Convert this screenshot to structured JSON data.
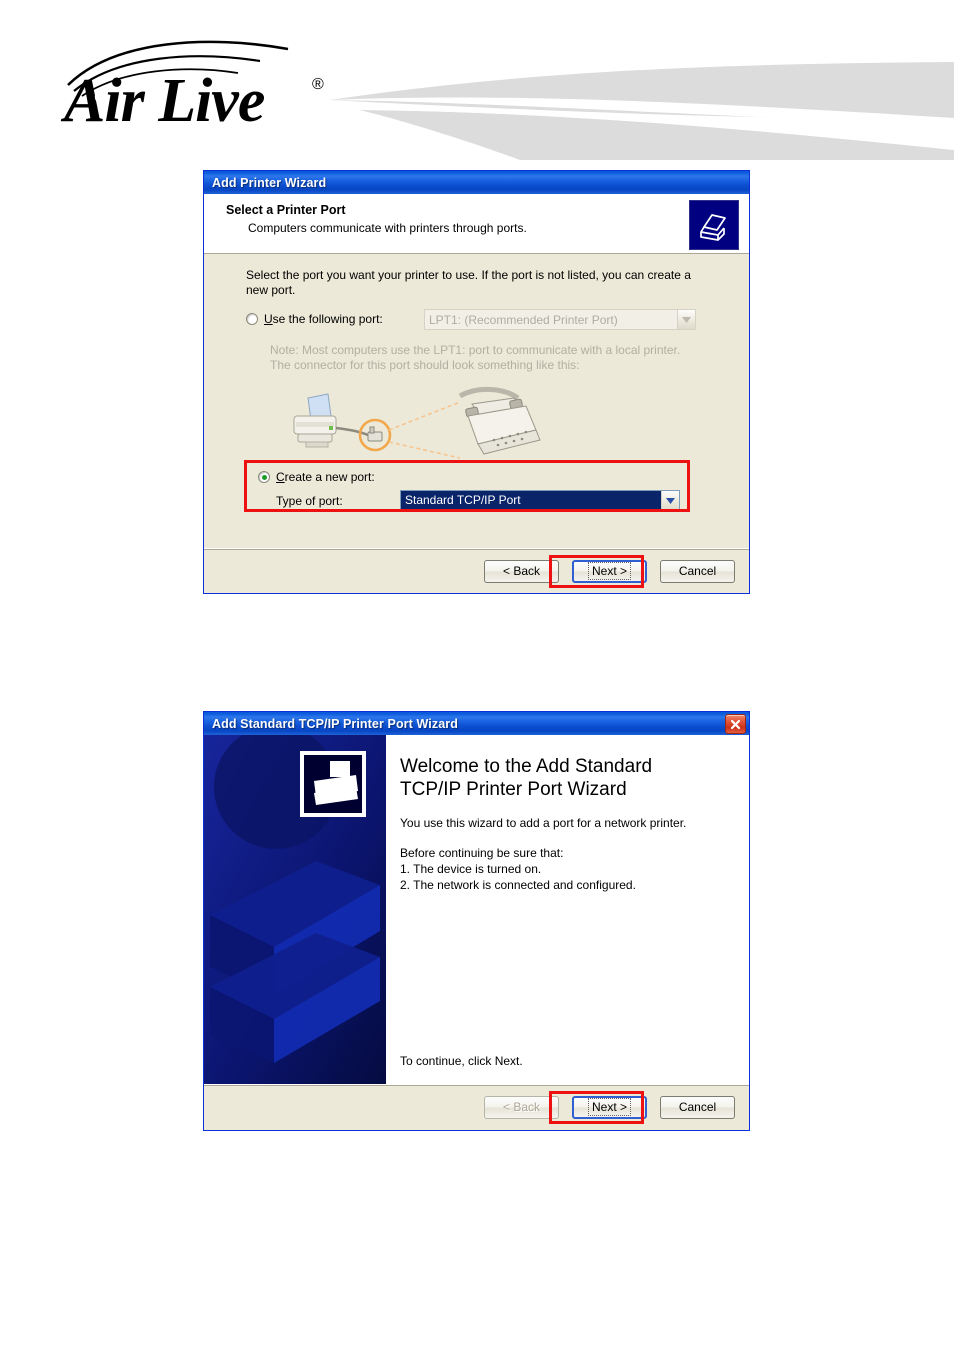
{
  "brand": {
    "name": "AirLive",
    "trademark": "®"
  },
  "dialog1": {
    "title": "Add Printer Wizard",
    "header_title": "Select a Printer Port",
    "header_subtitle": "Computers communicate with printers through ports.",
    "icon": "printer-icon",
    "intro": "Select the port you want your printer to use.  If the port is not listed, you can create a new port.",
    "option_existing": {
      "label_pre": "U",
      "label_accel": "U",
      "label": "Use the following port:",
      "selected": false,
      "combo_value": "LPT1: (Recommended Printer Port)",
      "disabled": true
    },
    "note_line1": "Note: Most computers use the LPT1: port to communicate with a local printer.",
    "note_line2": "The connector for this port should look something like this:",
    "option_new": {
      "label": "Create a new port:",
      "selected": true,
      "type_label": "Type of port:",
      "combo_value": "Standard TCP/IP Port"
    },
    "buttons": {
      "back": "< Back",
      "next": "Next >",
      "cancel": "Cancel",
      "back_disabled": false,
      "next_focused": true
    }
  },
  "dialog2": {
    "title": "Add Standard TCP/IP Printer Port Wizard",
    "close_icon": "close-icon",
    "heading_line1": "Welcome to the Add Standard",
    "heading_line2": "TCP/IP Printer Port Wizard",
    "paragraph": "You use this wizard to add a port for a network printer.",
    "before_title": "Before continuing be sure that:",
    "before_items": [
      "1.  The device is turned on.",
      "2.  The network is connected and configured."
    ],
    "continue_text": "To continue, click Next.",
    "buttons": {
      "back": "< Back",
      "next": "Next >",
      "cancel": "Cancel",
      "back_disabled": true,
      "next_focused": true
    }
  },
  "colors": {
    "titlebar_blue": "#0a4fd0",
    "dialog_face": "#ece9d8",
    "annotation_red": "#ee1111",
    "selection_blue": "#0a246a",
    "panel_navy": "#0c1a7a",
    "close_red": "#cc3018",
    "swoosh_gray": "#dcdcdc"
  }
}
